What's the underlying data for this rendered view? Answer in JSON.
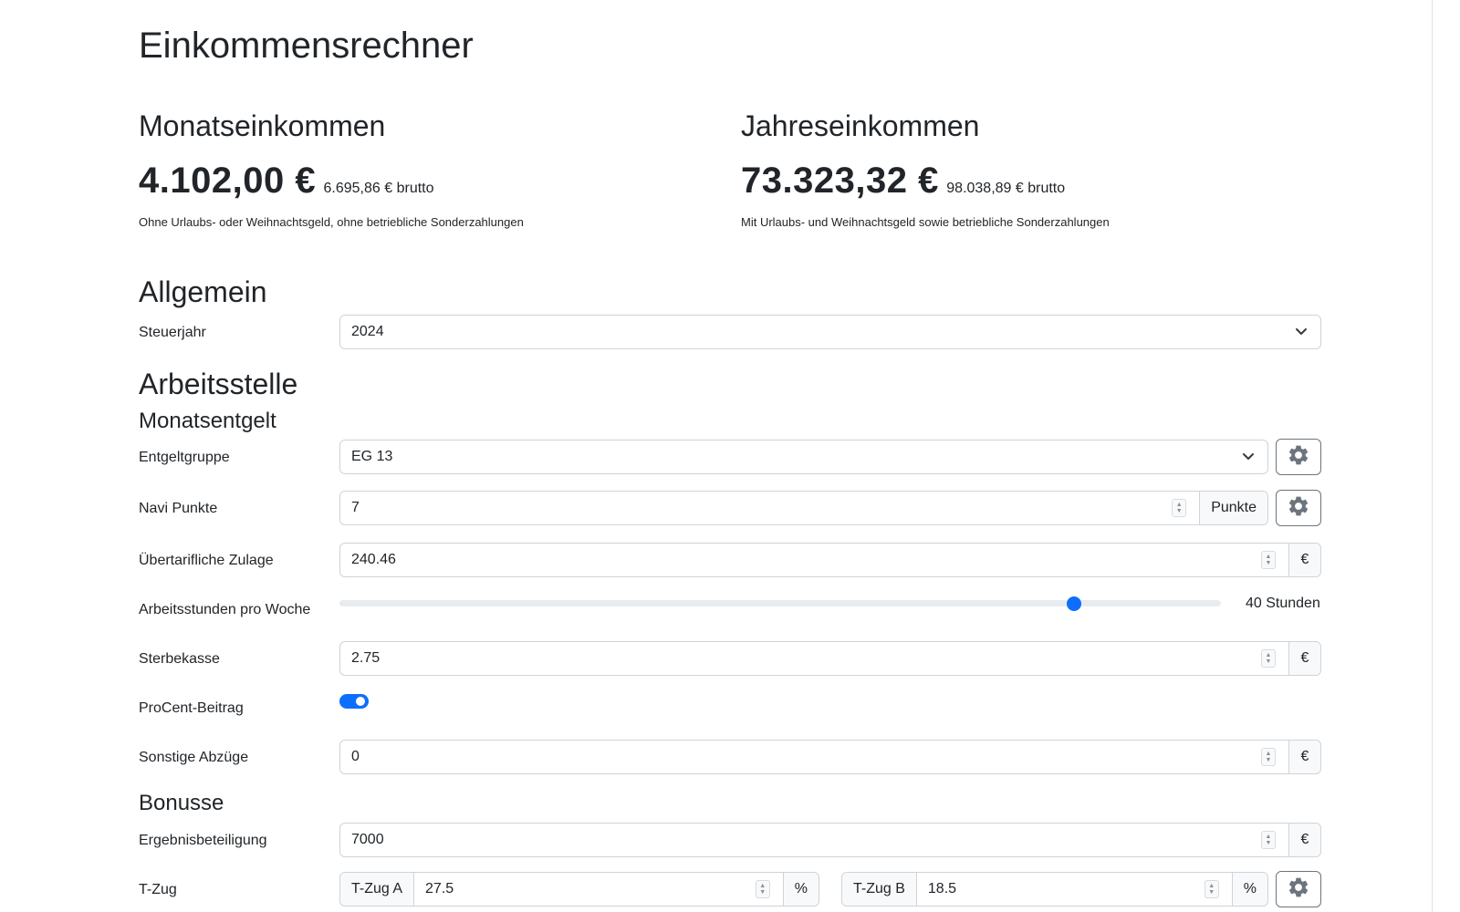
{
  "app_title": "Einkommensrechner",
  "summary": {
    "monthly": {
      "heading": "Monatseinkommen",
      "net": "4.102,00 €",
      "gross": "6.695,86 € brutto",
      "note": "Ohne Urlaubs- oder Weihnachtsgeld, ohne betriebliche Sonderzahlungen"
    },
    "yearly": {
      "heading": "Jahreseinkommen",
      "net": "73.323,32 €",
      "gross": "98.038,89 € brutto",
      "note": "Mit Urlaubs- und Weihnachtsgeld sowie betriebliche Sonderzahlungen"
    }
  },
  "general": {
    "heading": "Allgemein",
    "tax_year": {
      "label": "Steuerjahr",
      "value": "2024"
    }
  },
  "workplace": {
    "heading": "Arbeitsstelle",
    "monthly_pay": {
      "heading": "Monatsentgelt",
      "pay_group": {
        "label": "Entgeltgruppe",
        "value": "EG 13"
      },
      "navi_points": {
        "label": "Navi Punkte",
        "value": "7",
        "unit": "Punkte"
      },
      "allowance": {
        "label": "Übertarifliche Zulage",
        "value": "240.46",
        "unit": "€"
      },
      "weekly_hours": {
        "label": "Arbeitsstunden pro Woche",
        "value": 40,
        "display": "40 Stunden",
        "min": 0,
        "max": 48
      },
      "death_fund": {
        "label": "Sterbekasse",
        "value": "2.75",
        "unit": "€"
      },
      "procent": {
        "label": "ProCent-Beitrag",
        "checked": true
      },
      "other_deductions": {
        "label": "Sonstige Abzüge",
        "value": "0",
        "unit": "€"
      }
    },
    "bonuses": {
      "heading": "Bonusse",
      "profit_share": {
        "label": "Ergebnisbeteiligung",
        "value": "7000",
        "unit": "€"
      },
      "t_zug": {
        "label": "T-Zug",
        "a": {
          "prefix": "T-Zug A",
          "value": "27.5",
          "unit": "%"
        },
        "b": {
          "prefix": "T-Zug B",
          "value": "18.5",
          "unit": "%"
        }
      }
    }
  },
  "colors": {
    "accent": "#0d6efd",
    "border": "#ced4da",
    "addon_bg": "#f8f9fa",
    "text": "#212529"
  },
  "icons": {
    "settings": "gear-icon",
    "dropdown": "chevron-down-icon",
    "spinner": "spin-arrows-icon"
  }
}
